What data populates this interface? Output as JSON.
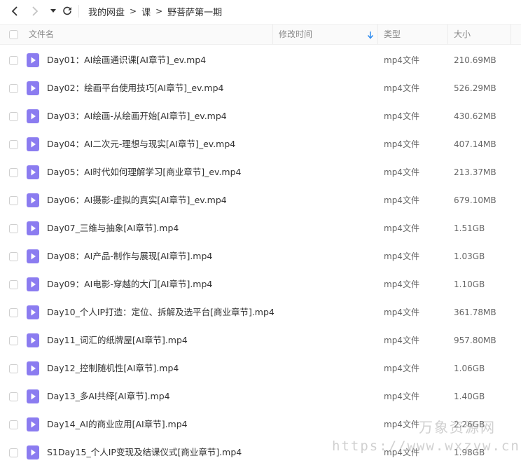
{
  "breadcrumb": [
    "我的网盘",
    "课",
    "野菩萨第一期"
  ],
  "breadcrumb_separator": ">",
  "columns": {
    "name": "文件名",
    "modified": "修改时间",
    "type": "类型",
    "size": "大小"
  },
  "sort": {
    "column": "modified",
    "direction": "descending"
  },
  "files": [
    {
      "name": "Day01：AI绘画通识课[AI章节]_ev.mp4",
      "type": "mp4文件",
      "size": "210.69MB"
    },
    {
      "name": "Day02：绘画平台使用技巧[AI章节]_ev.mp4",
      "type": "mp4文件",
      "size": "526.29MB"
    },
    {
      "name": "Day03：AI绘画-从绘画开始[AI章节]_ev.mp4",
      "type": "mp4文件",
      "size": "430.62MB"
    },
    {
      "name": "Day04：AI二次元-理想与现实[AI章节]_ev.mp4",
      "type": "mp4文件",
      "size": "407.14MB"
    },
    {
      "name": "Day05：AI时代如何理解学习[商业章节]_ev.mp4",
      "type": "mp4文件",
      "size": "213.37MB"
    },
    {
      "name": "Day06：AI摄影-虚拟的真实[AI章节]_ev.mp4",
      "type": "mp4文件",
      "size": "679.10MB"
    },
    {
      "name": "Day07_三维与抽象[AI章节].mp4",
      "type": "mp4文件",
      "size": "1.51GB"
    },
    {
      "name": "Day08：AI产品-制作与展现[AI章节].mp4",
      "type": "mp4文件",
      "size": "1.03GB"
    },
    {
      "name": "Day09：AI电影-穿越的大门[AI章节].mp4",
      "type": "mp4文件",
      "size": "1.10GB"
    },
    {
      "name": "Day10_个人IP打造：定位、拆解及选平台[商业章节].mp4",
      "type": "mp4文件",
      "size": "361.78MB"
    },
    {
      "name": "Day11_词汇的纸牌屋[AI章节].mp4",
      "type": "mp4文件",
      "size": "957.80MB"
    },
    {
      "name": "Day12_控制随机性[AI章节].mp4",
      "type": "mp4文件",
      "size": "1.06GB"
    },
    {
      "name": "Day13_多AI共绎[AI章节].mp4",
      "type": "mp4文件",
      "size": "1.40GB"
    },
    {
      "name": "Day14_AI的商业应用[AI章节].mp4",
      "type": "mp4文件",
      "size": "2.26GB"
    },
    {
      "name": "S1Day15_个人IP变现及结课仪式[商业章节].mp4",
      "type": "mp4文件",
      "size": "1.98GB"
    }
  ],
  "watermark": {
    "text": "万象资源网",
    "url": "https://www.wxzyw.cn"
  },
  "colors": {
    "icon": "#8b7cf0",
    "sort_arrow": "#2f8cf0",
    "watermark": "#aaaaaa"
  }
}
